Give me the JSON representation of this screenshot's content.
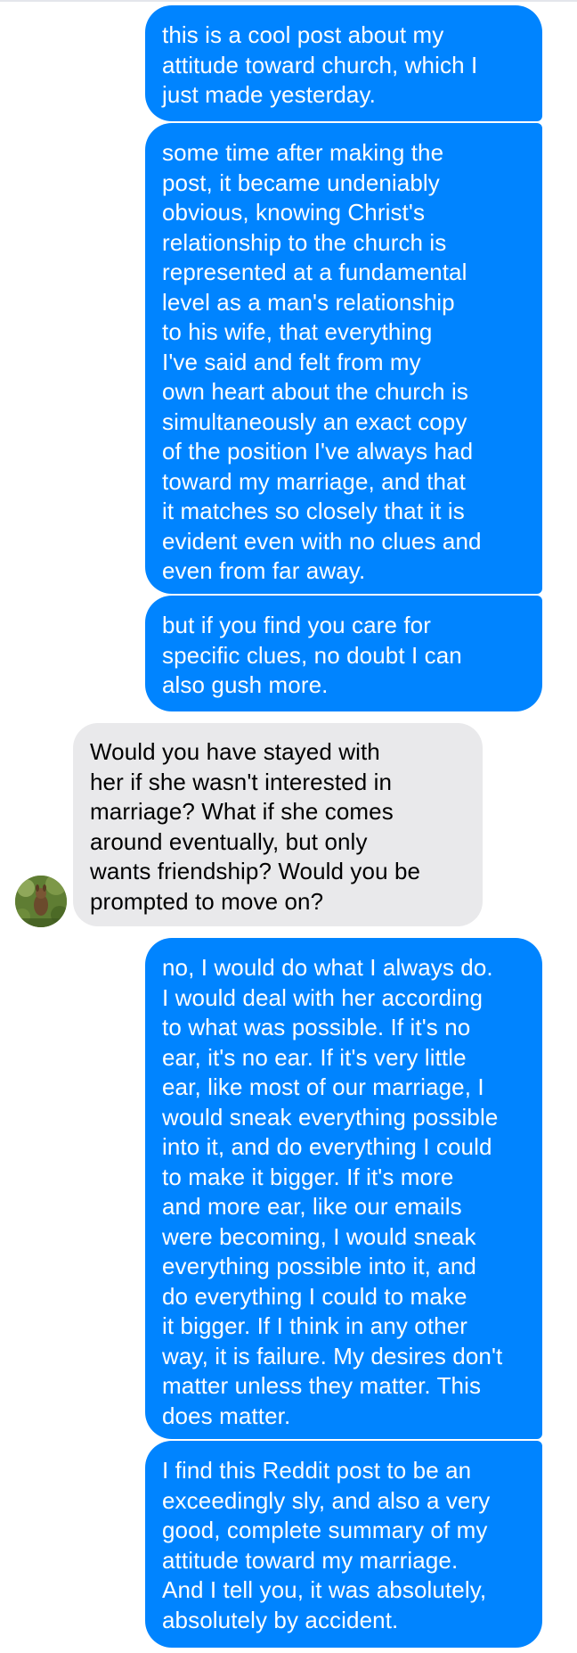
{
  "conversation": {
    "messages": [
      {
        "sender": "me",
        "text": "this is a cool post about my\nattitude toward church, which I\njust made yesterday."
      },
      {
        "sender": "me",
        "text": "some time after making the\npost, it became undeniably\nobvious, knowing Christ's\nrelationship to the church is\nrepresented at a fundamental\nlevel as a man's relationship\nto his wife, that everything\nI've said and felt from my\nown heart about the church is\nsimultaneously an exact copy\nof the position I've always had\ntoward my marriage, and that\nit matches so closely that it is\nevident even with no clues and\neven from far away."
      },
      {
        "sender": "me",
        "text": "but if you find you care for\nspecific clues, no doubt I can\nalso gush more."
      },
      {
        "sender": "them",
        "text": "Would you have stayed with\nher if she wasn't interested in\nmarriage? What if she comes\naround eventually, but only\nwants friendship? Would you be\nprompted to move on?"
      },
      {
        "sender": "me",
        "text": "no, I would do what I always do.\nI would deal with her according\nto what was possible. If it's no\near, it's no ear. If it's very little\near, like most of our marriage, I\nwould sneak everything possible\ninto it, and do everything I could\nto make it bigger. If it's more\nand more ear, like our emails\nwere becoming, I would sneak\neverything possible into it, and\ndo everything I could to make\nit bigger. If I think in any other\nway, it is failure. My desires don't\nmatter unless they matter. This\ndoes matter."
      },
      {
        "sender": "me",
        "text": "I find this Reddit post to be an\nexceedingly sly, and also a very\ngood, complete summary of my\nattitude toward my marriage.\nAnd I tell you, it was absolutely,\nabsolutely by accident."
      }
    ]
  },
  "colors": {
    "outgoing_bubble": "#0084ff",
    "incoming_bubble": "#e9e9eb",
    "outgoing_text": "#ffffff",
    "incoming_text": "#000000"
  },
  "icons": {
    "avatar": "contact-avatar-photo"
  }
}
